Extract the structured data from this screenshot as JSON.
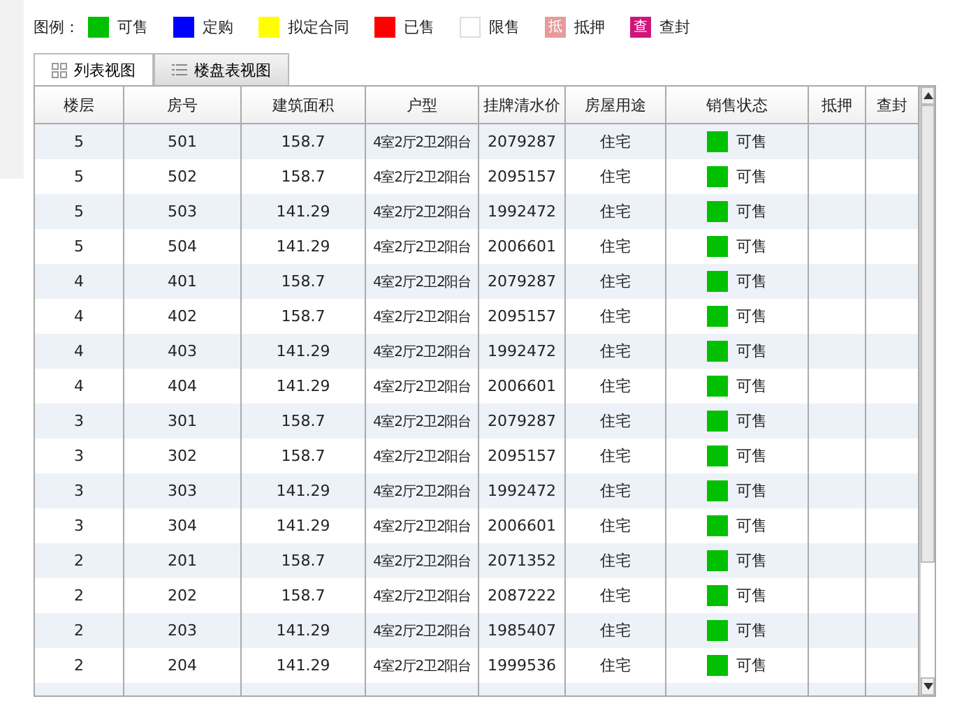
{
  "legend": {
    "label": "图例：",
    "items": [
      {
        "kind": "swatch",
        "color": "#00c000",
        "label": "可售"
      },
      {
        "kind": "swatch",
        "color": "#0000ff",
        "label": "定购"
      },
      {
        "kind": "swatch",
        "color": "#ffff00",
        "label": "拟定合同"
      },
      {
        "kind": "swatch",
        "color": "#ff0000",
        "label": "已售"
      },
      {
        "kind": "swatch",
        "color": "#ffffff",
        "label": "限售"
      },
      {
        "kind": "badge",
        "color": "#e89a9a",
        "badge_text": "抵",
        "label": "抵押"
      },
      {
        "kind": "badge",
        "color": "#d0157a",
        "badge_text": "查",
        "label": "查封"
      }
    ]
  },
  "tabs": [
    {
      "label": "列表视图",
      "selected": true
    },
    {
      "label": "楼盘表视图",
      "selected": false
    }
  ],
  "table": {
    "columns": [
      "楼层",
      "房号",
      "建筑面积",
      "户型",
      "挂牌清水价",
      "房屋用途",
      "销售状态",
      "抵押",
      "查封"
    ],
    "rows": [
      {
        "floor": "5",
        "room": "501",
        "area": "158.7",
        "layout": "4室2厅2卫2阳台",
        "price": "2079287",
        "use": "住宅",
        "status": "可售",
        "color": "#00c000"
      },
      {
        "floor": "5",
        "room": "502",
        "area": "158.7",
        "layout": "4室2厅2卫2阳台",
        "price": "2095157",
        "use": "住宅",
        "status": "可售",
        "color": "#00c000"
      },
      {
        "floor": "5",
        "room": "503",
        "area": "141.29",
        "layout": "4室2厅2卫2阳台",
        "price": "1992472",
        "use": "住宅",
        "status": "可售",
        "color": "#00c000"
      },
      {
        "floor": "5",
        "room": "504",
        "area": "141.29",
        "layout": "4室2厅2卫2阳台",
        "price": "2006601",
        "use": "住宅",
        "status": "可售",
        "color": "#00c000"
      },
      {
        "floor": "4",
        "room": "401",
        "area": "158.7",
        "layout": "4室2厅2卫2阳台",
        "price": "2079287",
        "use": "住宅",
        "status": "可售",
        "color": "#00c000"
      },
      {
        "floor": "4",
        "room": "402",
        "area": "158.7",
        "layout": "4室2厅2卫2阳台",
        "price": "2095157",
        "use": "住宅",
        "status": "可售",
        "color": "#00c000"
      },
      {
        "floor": "4",
        "room": "403",
        "area": "141.29",
        "layout": "4室2厅2卫2阳台",
        "price": "1992472",
        "use": "住宅",
        "status": "可售",
        "color": "#00c000"
      },
      {
        "floor": "4",
        "room": "404",
        "area": "141.29",
        "layout": "4室2厅2卫2阳台",
        "price": "2006601",
        "use": "住宅",
        "status": "可售",
        "color": "#00c000"
      },
      {
        "floor": "3",
        "room": "301",
        "area": "158.7",
        "layout": "4室2厅2卫2阳台",
        "price": "2079287",
        "use": "住宅",
        "status": "可售",
        "color": "#00c000"
      },
      {
        "floor": "3",
        "room": "302",
        "area": "158.7",
        "layout": "4室2厅2卫2阳台",
        "price": "2095157",
        "use": "住宅",
        "status": "可售",
        "color": "#00c000"
      },
      {
        "floor": "3",
        "room": "303",
        "area": "141.29",
        "layout": "4室2厅2卫2阳台",
        "price": "1992472",
        "use": "住宅",
        "status": "可售",
        "color": "#00c000"
      },
      {
        "floor": "3",
        "room": "304",
        "area": "141.29",
        "layout": "4室2厅2卫2阳台",
        "price": "2006601",
        "use": "住宅",
        "status": "可售",
        "color": "#00c000"
      },
      {
        "floor": "2",
        "room": "201",
        "area": "158.7",
        "layout": "4室2厅2卫2阳台",
        "price": "2071352",
        "use": "住宅",
        "status": "可售",
        "color": "#00c000"
      },
      {
        "floor": "2",
        "room": "202",
        "area": "158.7",
        "layout": "4室2厅2卫2阳台",
        "price": "2087222",
        "use": "住宅",
        "status": "可售",
        "color": "#00c000"
      },
      {
        "floor": "2",
        "room": "203",
        "area": "141.29",
        "layout": "4室2厅2卫2阳台",
        "price": "1985407",
        "use": "住宅",
        "status": "可售",
        "color": "#00c000"
      },
      {
        "floor": "2",
        "room": "204",
        "area": "141.29",
        "layout": "4室2厅2卫2阳台",
        "price": "1999536",
        "use": "住宅",
        "status": "可售",
        "color": "#00c000"
      }
    ]
  }
}
